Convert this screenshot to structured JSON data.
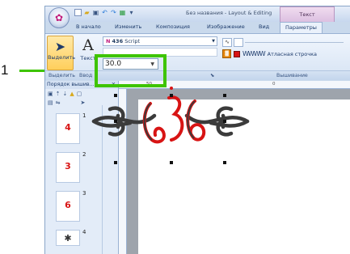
{
  "callout": {
    "number": "1"
  },
  "window": {
    "title": "Без названия - Layout & Editing",
    "context_tab": "Текст"
  },
  "quick_access": [
    "new-icon",
    "open-icon",
    "save-icon",
    "undo-icon",
    "redo-icon"
  ],
  "tabs": [
    "В начало",
    "Изменить",
    "Композиция",
    "Изображение",
    "Вид",
    "Параметры"
  ],
  "active_tab": "Параметры",
  "ribbon": {
    "select_label": "Выделить",
    "text_label": "Текст",
    "text_icon": "A",
    "font_prefix": "N",
    "font_sample": "436",
    "font_name": "Script",
    "size_value": "30.0",
    "stitch_name": "Атласная строчка",
    "group_labels": [
      "Выделить",
      "Ввод",
      "Вышивание"
    ]
  },
  "panel": {
    "title": "Порядок вышив...",
    "thumb_numbers": [
      "1",
      "2",
      "3",
      "4"
    ],
    "thumb_glyphs": [
      "4",
      "3",
      "6",
      "✱"
    ]
  },
  "ruler": {
    "top_labels": [
      "50",
      "0"
    ]
  },
  "colors": {
    "accent_green": "#3ec400",
    "thread_red": "#d81414",
    "thread_dark": "#3b3b3b"
  }
}
